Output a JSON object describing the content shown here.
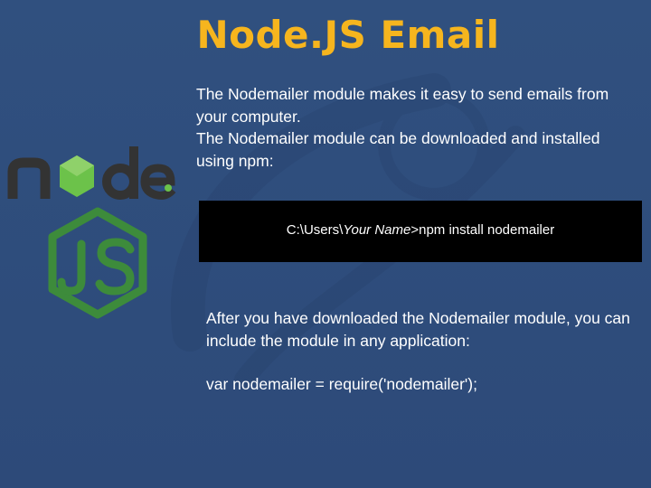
{
  "slide": {
    "title": "Node.JS Email",
    "intro": {
      "line1": "The Nodemailer module makes it easy to send emails from your computer.",
      "line2": "The Nodemailer module can be downloaded and installed using npm:"
    },
    "command": {
      "prefix": "C:\\Users\\",
      "user_placeholder": "Your Name",
      "suffix": ">npm install nodemailer"
    },
    "after": {
      "text": "After you have downloaded the Nodemailer module, you can include the module in any application:",
      "code": "var nodemailer = require('nodemailer');"
    },
    "logo": {
      "node_text": "node",
      "js_text": "JS"
    }
  },
  "colors": {
    "background": "#2f4d7e",
    "title": "#f6b51e",
    "logo_green": "#3d8b3b",
    "logo_dark": "#333333"
  }
}
